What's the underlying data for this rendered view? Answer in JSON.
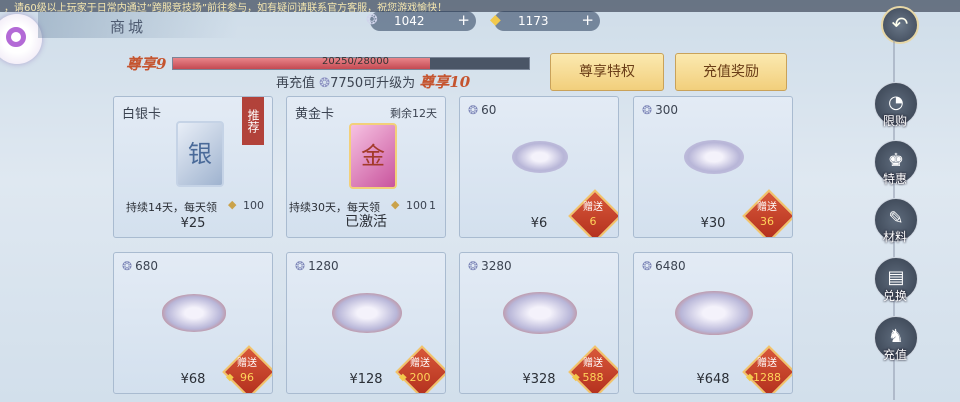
{
  "notice": "，请60级以上玩家于日常内通过“跨服竞技场”前往参与，如有疑问请联系官方客服，祝您游戏愉快！",
  "title": "商城",
  "currency": [
    {
      "icon": "jade-coin-icon",
      "value": "1042",
      "plus": "+"
    },
    {
      "icon": "gold-ingot-icon",
      "value": "1173",
      "plus": "+"
    }
  ],
  "vip": {
    "current": "尊享9",
    "progress_text": "20250/28000",
    "progress_fraction": 0.723,
    "prefix": "再充值",
    "amount": "7750",
    "suffix": "可升级为",
    "next": "尊享10"
  },
  "buttons": {
    "privilege": "尊享特权",
    "recharge_reward": "充值奖励"
  },
  "cards": {
    "silver": {
      "name": "白银卡",
      "seal": "银",
      "ribbon": "推荐",
      "desc": "持续14天，每天领",
      "daily": "100",
      "price": "¥25"
    },
    "gold": {
      "name": "黄金卡",
      "seal": "金",
      "remaining": "剩余12天",
      "desc": "持续30天，每天领",
      "daily": "100",
      "daily_tail": "1",
      "price": "已激活"
    },
    "packs": [
      {
        "gems": "60",
        "price": "¥6",
        "bonus_label": "赠送",
        "bonus": "6"
      },
      {
        "gems": "300",
        "price": "¥30",
        "bonus_label": "赠送",
        "bonus": "36"
      },
      {
        "gems": "680",
        "price": "¥68",
        "bonus_label": "赠送",
        "bonus": "96"
      },
      {
        "gems": "1280",
        "price": "¥128",
        "bonus_label": "赠送",
        "bonus": "200"
      },
      {
        "gems": "3280",
        "price": "¥328",
        "bonus_label": "赠送",
        "bonus": "588"
      },
      {
        "gems": "6480",
        "price": "¥648",
        "bonus_label": "赠送",
        "bonus": "1288"
      }
    ]
  },
  "sidebar": [
    {
      "label": "限购",
      "icon": "timer-icon"
    },
    {
      "label": "特惠",
      "icon": "gift-bag-icon"
    },
    {
      "label": "材料",
      "icon": "material-icon"
    },
    {
      "label": "兑换",
      "icon": "ticket-icon"
    },
    {
      "label": "充值",
      "icon": "money-bag-icon"
    }
  ],
  "colors": {
    "accent_red": "#c5542f",
    "bonus_red": "#b3301d",
    "gold_button": "#f2cf7c"
  }
}
